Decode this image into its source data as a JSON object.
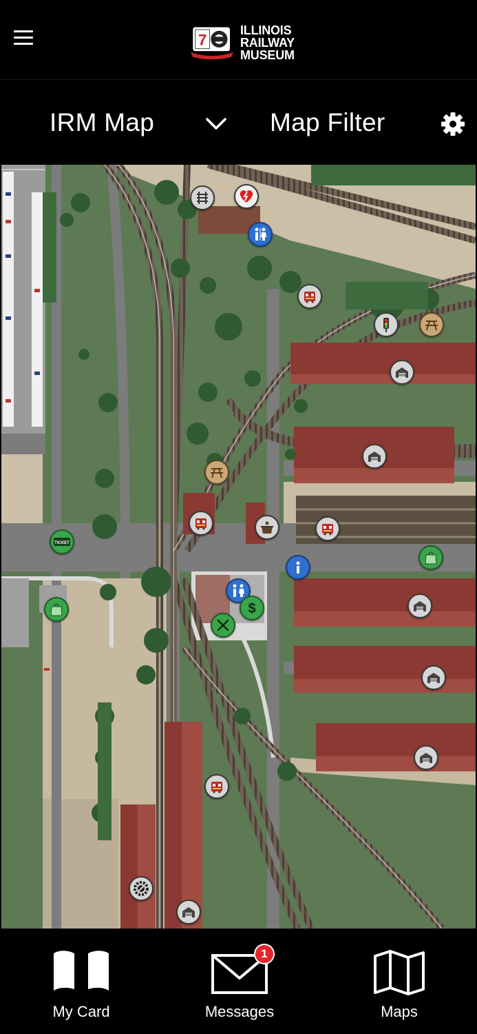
{
  "header": {
    "logo_line1": "ILLINOIS",
    "logo_line2": "RAILWAY",
    "logo_line3": "MUSEUM",
    "logo_badge_number": "70"
  },
  "selector": {
    "map_title": "IRM Map",
    "filter_label": "Map Filter"
  },
  "map_pins": [
    {
      "name": "track-icon",
      "style": "grey"
    },
    {
      "name": "aed-icon",
      "style": "white"
    },
    {
      "name": "restroom-icon",
      "style": "blue"
    },
    {
      "name": "streetcar-icon",
      "style": "grey"
    },
    {
      "name": "signal-icon",
      "style": "grey"
    },
    {
      "name": "picnic-icon",
      "style": "tan"
    },
    {
      "name": "barn-icon",
      "style": "grey"
    },
    {
      "name": "barn-icon",
      "style": "grey"
    },
    {
      "name": "picnic-icon",
      "style": "tan"
    },
    {
      "name": "streetcar-icon",
      "style": "grey"
    },
    {
      "name": "concession-icon",
      "style": "grey"
    },
    {
      "name": "streetcar-icon",
      "style": "grey"
    },
    {
      "name": "shopping-bag-icon",
      "style": "green"
    },
    {
      "name": "ticket-icon",
      "style": "green"
    },
    {
      "name": "info-icon",
      "style": "blue"
    },
    {
      "name": "restroom-icon",
      "style": "blue"
    },
    {
      "name": "money-icon",
      "style": "green"
    },
    {
      "name": "food-icon",
      "style": "green"
    },
    {
      "name": "shopping-bag-icon",
      "style": "green"
    },
    {
      "name": "barn-icon",
      "style": "grey"
    },
    {
      "name": "barn-icon",
      "style": "grey"
    },
    {
      "name": "barn-icon",
      "style": "grey"
    },
    {
      "name": "streetcar-icon",
      "style": "grey"
    },
    {
      "name": "shop-gear-icon",
      "style": "grey"
    },
    {
      "name": "barn-icon",
      "style": "grey"
    }
  ],
  "map_ticket_text": "TICKET",
  "nav": {
    "my_card": "My Card",
    "messages": "Messages",
    "maps": "Maps",
    "messages_badge": "1"
  },
  "colors": {
    "background": "#000000",
    "grass": "#5e7a55",
    "road": "#7b7b7b",
    "building_roof": "#8b3a33",
    "badge_red": "#e3262b",
    "pin_blue": "#2f6fce",
    "pin_green": "#3aa54a"
  }
}
